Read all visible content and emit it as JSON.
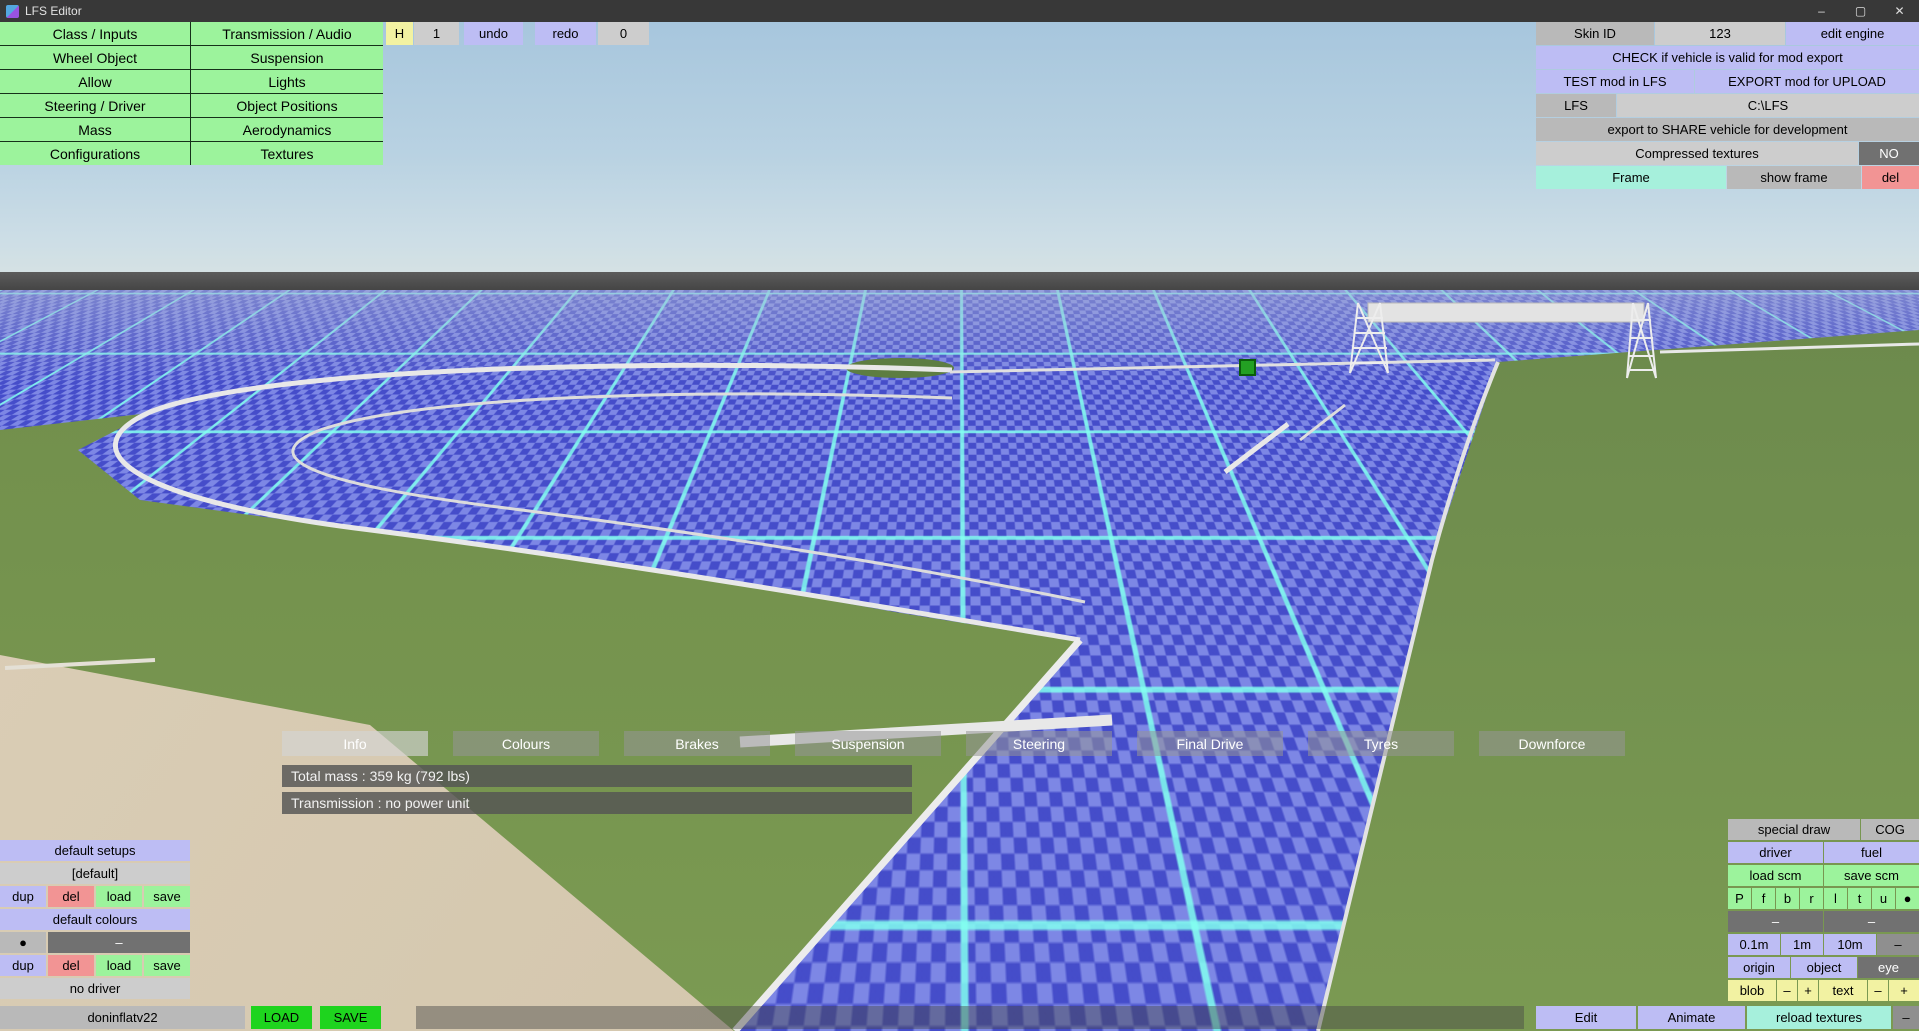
{
  "window": {
    "title": "LFS Editor",
    "controls": {
      "minimize": "–",
      "maximize": "▢",
      "close": "✕"
    }
  },
  "colors": {
    "button_green": "#9cf39c",
    "button_purple": "#bdbdf4",
    "button_cyan": "#a6f0dc",
    "button_yellow": "#f2f2a2",
    "button_red": "#f29494",
    "grid_cyan": "#82fff0",
    "ground_blue": "#4e58d4"
  },
  "menu": {
    "items": [
      {
        "label": "Class / Inputs"
      },
      {
        "label": "Transmission / Audio"
      },
      {
        "label": "Wheel Object"
      },
      {
        "label": "Suspension"
      },
      {
        "label": "Allow"
      },
      {
        "label": "Lights"
      },
      {
        "label": "Steering / Driver"
      },
      {
        "label": "Object Positions"
      },
      {
        "label": "Mass"
      },
      {
        "label": "Aerodynamics"
      },
      {
        "label": "Configurations"
      },
      {
        "label": "Textures"
      }
    ]
  },
  "history": {
    "h_label": "H",
    "h_value": "1",
    "undo_label": "undo",
    "redo_label": "redo",
    "redo_value": "0"
  },
  "export_panel": {
    "skin_id_label": "Skin ID",
    "skin_id_value": "123",
    "edit_engine": "edit engine",
    "check": "CHECK if vehicle is valid for mod export",
    "test": "TEST mod in LFS",
    "export": "EXPORT mod for UPLOAD",
    "lfs": "LFS",
    "lfs_path": "C:\\LFS",
    "share": "export to SHARE vehicle for development",
    "compressed": "Compressed textures",
    "compressed_value": "NO",
    "frame": "Frame",
    "show_frame": "show frame",
    "frame_del": "del"
  },
  "tabs": [
    {
      "label": "Info"
    },
    {
      "label": "Colours"
    },
    {
      "label": "Brakes"
    },
    {
      "label": "Suspension"
    },
    {
      "label": "Steering"
    },
    {
      "label": "Final Drive"
    },
    {
      "label": "Tyres"
    },
    {
      "label": "Downforce"
    }
  ],
  "info_panel": {
    "line1": "Total mass : 359 kg (792 lbs)",
    "line2": "Transmission : no power unit"
  },
  "setups_panel": {
    "default_setups": "default setups",
    "current": "[default]",
    "dup": "dup",
    "del": "del",
    "load": "load",
    "save": "save",
    "default_colours": "default colours",
    "dot": "●",
    "dash": "–",
    "no_driver": "no driver"
  },
  "bottom_bar": {
    "mod_name": "doninflatv22",
    "load": "LOAD",
    "save": "SAVE"
  },
  "view_panel": {
    "special_draw": "special draw",
    "cog": "COG",
    "driver": "driver",
    "fuel": "fuel",
    "load_scm": "load scm",
    "save_scm": "save scm",
    "letters": [
      "P",
      "f",
      "b",
      "r",
      "l",
      "t",
      "u",
      "●"
    ],
    "dash1": "–",
    "dash2": "–",
    "m01": "0.1m",
    "m1": "1m",
    "m10": "10m",
    "m_dash": "–",
    "origin": "origin",
    "object": "object",
    "eye": "eye",
    "blob": "blob",
    "blob_minus": "–",
    "blob_plus": "+",
    "text": "text",
    "text_minus": "–",
    "text_plus": "+",
    "edit": "Edit",
    "animate": "Animate",
    "reload_textures": "reload textures",
    "reload_dash": "–"
  }
}
